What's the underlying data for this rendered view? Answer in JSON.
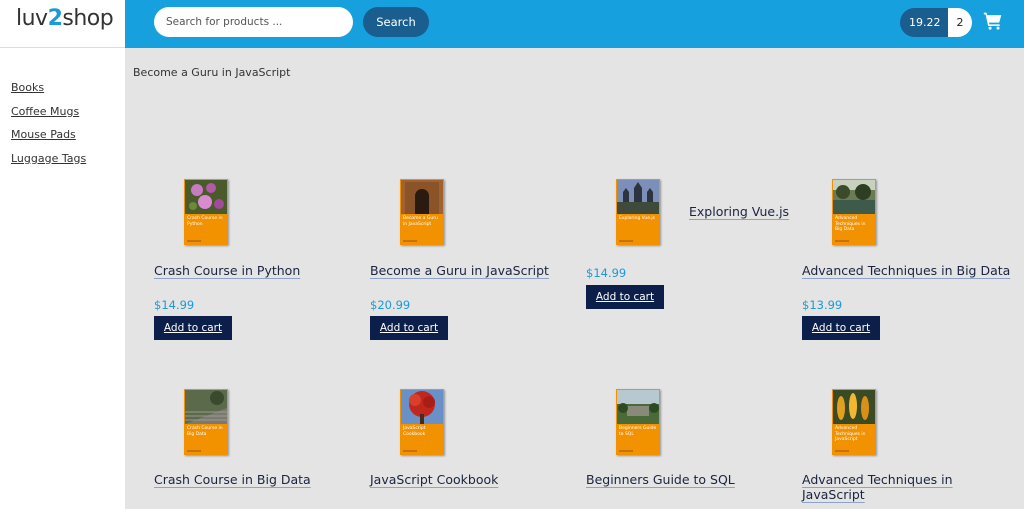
{
  "header": {
    "logo_text_left": "luv",
    "logo_text_mid": "2",
    "logo_text_right": "shop",
    "search_placeholder": "Search for products ...",
    "search_button": "Search",
    "cart_total": "19.22",
    "cart_quantity": "2",
    "cart_icon": "shopping-cart-icon"
  },
  "sidebar": {
    "categories": [
      "Books",
      "Coffee Mugs",
      "Mouse Pads",
      "Luggage Tags"
    ]
  },
  "main": {
    "heading": "Become a Guru in JavaScript",
    "products": [
      {
        "title": "Crash Course in Python",
        "cover_title": "Crash Course in Python",
        "price": "$14.99",
        "button": "Add to cart",
        "cover_photo": "flowers"
      },
      {
        "title": "Become a Guru in JavaScript",
        "cover_title": "Become a Guru in JavaScript",
        "price": "$20.99",
        "button": "Add to cart",
        "cover_photo": "doorway"
      },
      {
        "title": "Exploring Vue.js",
        "cover_title": "Exploring Vue.js",
        "price": "$14.99",
        "button": "Add to cart",
        "cover_photo": "temple"
      },
      {
        "title": "Advanced Techniques in Big Data",
        "cover_title": "Advanced Techniques in Big Data",
        "price": "$13.99",
        "button": "Add to cart",
        "cover_photo": "lake"
      },
      {
        "title": "Crash Course in Big Data",
        "cover_title": "Crash Course in Big Data",
        "price": "",
        "button": "",
        "cover_photo": "stairs"
      },
      {
        "title": "JavaScript Cookbook",
        "cover_title": "JavaScript Cookbook",
        "price": "",
        "button": "",
        "cover_photo": "red-tree"
      },
      {
        "title": "Beginners Guide to SQL",
        "cover_title": "Beginners Guide to SQL",
        "price": "",
        "button": "",
        "cover_photo": "ruins"
      },
      {
        "title": "Advanced Techniques in JavaScript",
        "cover_title": "Advanced Techniques in JavaScript",
        "price": "",
        "button": "",
        "cover_photo": "plants"
      }
    ]
  },
  "colors": {
    "header_bg": "#16a0de",
    "button_dark_blue": "#1a5d8f",
    "add_to_cart_bg": "#0c1f4a",
    "price_blue": "#1a9ad7",
    "cover_orange": "#f39200",
    "page_bg": "#e4e4e4"
  }
}
